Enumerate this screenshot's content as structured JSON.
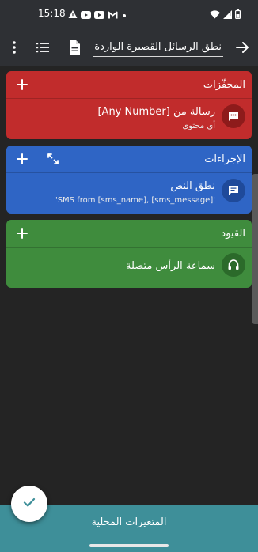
{
  "status_bar": {
    "time": "15:18",
    "left_icons": [
      "warning-icon",
      "youtube-icon",
      "youtube-icon",
      "gmail-icon",
      "dot-icon"
    ],
    "right_icons": [
      "wifi-icon",
      "signal-icon",
      "battery-icon"
    ]
  },
  "app_bar": {
    "title_value": "نطق الرسائل القصيرة الواردة",
    "icons": [
      "back-arrow-icon",
      "document-icon",
      "list-icon",
      "more-vert-icon"
    ]
  },
  "sections": {
    "triggers": {
      "title": "المحفّزات",
      "color": "#c12c2c",
      "item": {
        "icon": "sms-icon",
        "title": "رسالة من [Any Number]",
        "subtitle": "أي محتوى"
      }
    },
    "actions": {
      "title": "الإجراءات",
      "color": "#2f65c5",
      "item": {
        "icon": "message-icon",
        "title": "نطق النص",
        "subtitle": "'SMS from [sms_name], [sms_message]'"
      }
    },
    "constraints": {
      "title": "القيود",
      "color": "#3f8c3d",
      "item": {
        "icon": "headphones-icon",
        "title": "سماعة الرأس متصلة"
      }
    }
  },
  "bottom_bar": {
    "label": "المتغيرات المحلية",
    "color": "#3e8f99"
  }
}
